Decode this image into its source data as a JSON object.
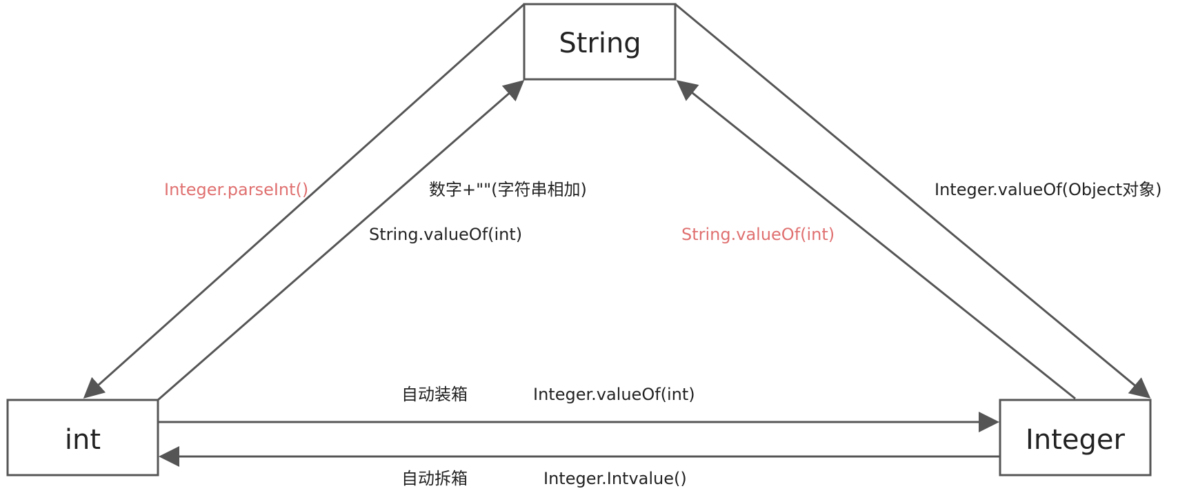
{
  "colors": {
    "stroke": "#555555",
    "text": "#222222",
    "highlight": "#e07070",
    "background": "#ffffff"
  },
  "nodes": {
    "string": {
      "label": "String"
    },
    "int": {
      "label": "int"
    },
    "integer": {
      "label": "Integer"
    }
  },
  "edges": {
    "string_to_int": {
      "label": "Integer.parseInt()",
      "color": "highlight"
    },
    "int_to_string": {
      "label_top": "数字+\"\"(字符串相加)",
      "label_bottom": "String.valueOf(int)",
      "color": "text"
    },
    "integer_to_string": {
      "label": "String.valueOf(int)",
      "color": "highlight"
    },
    "string_to_integer": {
      "label": "Integer.valueOf(Object对象)",
      "color": "text"
    },
    "int_to_integer": {
      "label_left": "自动装箱",
      "label_right": "Integer.valueOf(int)",
      "color": "text"
    },
    "integer_to_int": {
      "label_left": "自动拆箱",
      "label_right": "Integer.Intvalue()",
      "color": "text"
    }
  }
}
